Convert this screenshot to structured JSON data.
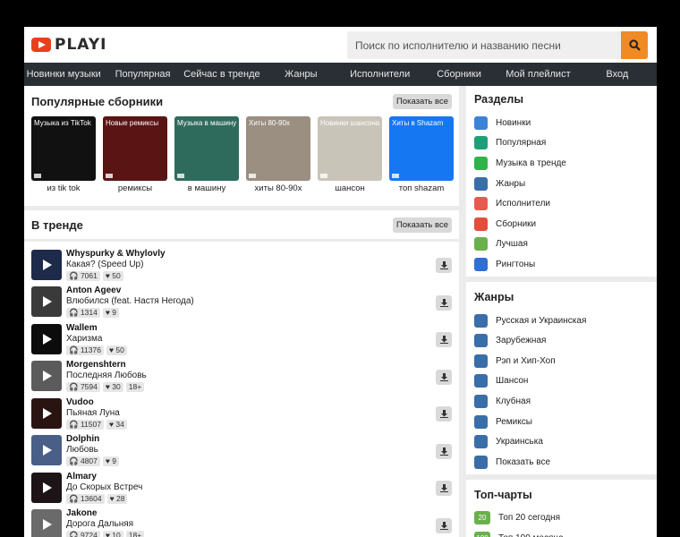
{
  "logo": {
    "text": "PLAYI"
  },
  "search": {
    "placeholder": "Поиск по исполнителю и названию песни"
  },
  "nav": [
    "Новинки музыки",
    "Популярная",
    "Сейчас в тренде",
    "Жанры",
    "Исполнители",
    "Сборники",
    "Мой плейлист",
    "Вход"
  ],
  "collections": {
    "title": "Популярные сборники",
    "show_all": "Показать все",
    "items": [
      {
        "cover_title": "Музыка из TikTok",
        "name": "из tik tok",
        "color": "#111111"
      },
      {
        "cover_title": "Новые ремиксы",
        "name": "ремиксы",
        "color": "#5a1414"
      },
      {
        "cover_title": "Музыка в машину",
        "name": "в машину",
        "color": "#2f6b5d"
      },
      {
        "cover_title": "Хиты 80-90х",
        "name": "хиты 80-90х",
        "color": "#9a8f80"
      },
      {
        "cover_title": "Новинки шансона",
        "name": "шансон",
        "color": "#c9c4b8"
      },
      {
        "cover_title": "Хиты в Shazam",
        "name": "топ shazam",
        "color": "#1677f2"
      }
    ]
  },
  "trending": {
    "title": "В тренде",
    "show_all": "Показать все",
    "tracks": [
      {
        "artist": "Whyspurky & Whylovly",
        "title": "Какая? (Speed Up)",
        "plays": "7061",
        "likes": "50",
        "badge": "",
        "color": "#1d2a4a"
      },
      {
        "artist": "Anton Ageev",
        "title": "Влюбился (feat. Настя Негода)",
        "plays": "1314",
        "likes": "9",
        "badge": "",
        "color": "#3a3a3a"
      },
      {
        "artist": "Wallem",
        "title": "Харизма",
        "plays": "11376",
        "likes": "50",
        "badge": "",
        "color": "#0c0c0c"
      },
      {
        "artist": "Morgenshtern",
        "title": "Последняя Любовь",
        "plays": "7594",
        "likes": "30",
        "badge": "18+",
        "color": "#5b5b5b"
      },
      {
        "artist": "Vudoo",
        "title": "Пьяная Луна",
        "plays": "11507",
        "likes": "34",
        "badge": "",
        "color": "#2a1412"
      },
      {
        "artist": "Dolphin",
        "title": "Любовь",
        "plays": "4807",
        "likes": "9",
        "badge": "",
        "color": "#4a5f88"
      },
      {
        "artist": "Almary",
        "title": "До Скорых Встреч",
        "plays": "13604",
        "likes": "28",
        "badge": "",
        "color": "#1c1416"
      },
      {
        "artist": "Jakone",
        "title": "Дорога Дальняя",
        "plays": "9724",
        "likes": "10",
        "badge": "18+",
        "color": "#6a6a6a"
      }
    ]
  },
  "sidebar": {
    "sections_title": "Разделы",
    "sections": [
      {
        "label": "Новинки",
        "icon": "music-note-icon",
        "color": "#3b82d9"
      },
      {
        "label": "Популярная",
        "icon": "star-icon",
        "color": "#1f9e7a"
      },
      {
        "label": "Музыка в тренде",
        "icon": "chart-icon",
        "color": "#2fb34a"
      },
      {
        "label": "Жанры",
        "icon": "folder-icon",
        "color": "#3a6ea8"
      },
      {
        "label": "Исполнители",
        "icon": "people-icon",
        "color": "#e85a4f"
      },
      {
        "label": "Сборники",
        "icon": "collection-icon",
        "color": "#e44d3a"
      },
      {
        "label": "Лучшая",
        "icon": "leaf-icon",
        "color": "#6ab04c"
      },
      {
        "label": "Рингтоны",
        "icon": "phone-icon",
        "color": "#2f6fd6"
      }
    ],
    "genres_title": "Жанры",
    "genres": [
      "Русская и Украинская",
      "Зарубежная",
      "Рэп и Хип-Хоп",
      "Шансон",
      "Клубная",
      "Ремиксы",
      "Украинська",
      "Показать все"
    ],
    "charts_title": "Топ-чарты",
    "charts": [
      {
        "num": "20",
        "label": "Топ 20 сегодня"
      },
      {
        "num": "100",
        "label": "Топ 100 месяца"
      }
    ]
  }
}
